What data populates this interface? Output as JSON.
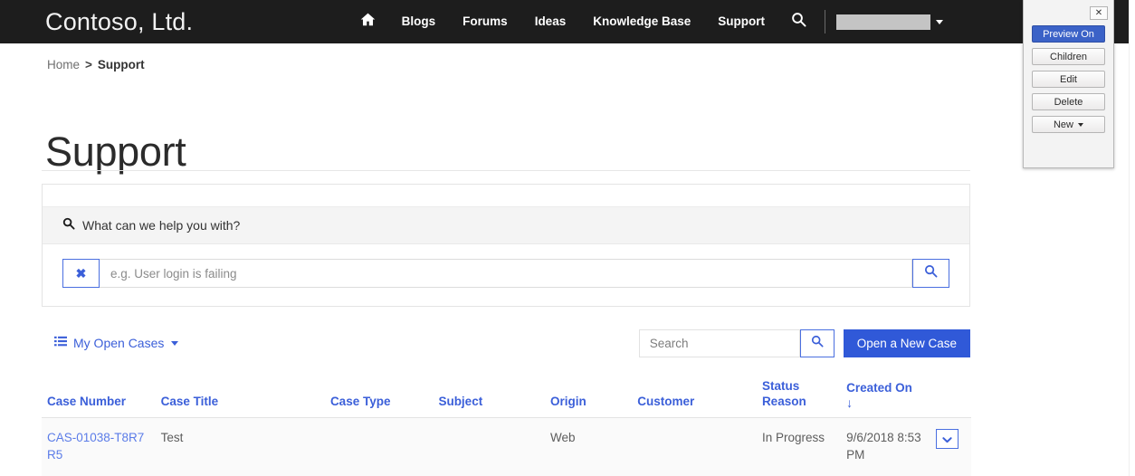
{
  "navbar": {
    "brand": "Contoso, Ltd.",
    "home_icon": "home-icon",
    "search_icon": "search-icon",
    "items": [
      {
        "label": "Blogs"
      },
      {
        "label": "Forums"
      },
      {
        "label": "Ideas"
      },
      {
        "label": "Knowledge Base"
      },
      {
        "label": "Support"
      }
    ],
    "user": {
      "name": "",
      "caret": "chevron-down-icon"
    },
    "background": "#1d1d1d"
  },
  "breadcrumb": {
    "home": "Home",
    "separator": ">",
    "current": "Support"
  },
  "page": {
    "title": "Support"
  },
  "help_search": {
    "heading": "What can we help you with?",
    "heading_icon": "search-icon",
    "clear_label": "✖",
    "input_value": "",
    "input_placeholder": "e.g. User login is failing",
    "submit_icon": "search-icon"
  },
  "toolbar": {
    "view_icon": "list-icon",
    "view_label": "My Open Cases",
    "view_caret": "caret-down-icon",
    "search_value": "",
    "search_placeholder": "Search",
    "search_icon": "search-icon",
    "new_case_label": "Open a New Case",
    "accent_color": "#3059d8"
  },
  "grid": {
    "columns": [
      {
        "label": "Case Number",
        "sorted": false
      },
      {
        "label": "Case Title",
        "sorted": false
      },
      {
        "label": "Case Type",
        "sorted": false
      },
      {
        "label": "Subject",
        "sorted": false
      },
      {
        "label": "Origin",
        "sorted": false
      },
      {
        "label": "Customer",
        "sorted": false
      },
      {
        "label": "Status Reason",
        "sorted": false
      },
      {
        "label": "Created On",
        "sorted": true,
        "sort_arrow": "↓"
      }
    ],
    "rows": [
      {
        "case_number": "CAS-01038-T8R7R5",
        "case_title": "Test",
        "case_type": "",
        "subject": "",
        "origin": "Web",
        "customer": "",
        "status_reason": "In Progress",
        "created_on": "9/6/2018 8:53 PM",
        "menu_icon": "chevron-down-icon"
      }
    ]
  },
  "edit_panel": {
    "close_label": "✕",
    "buttons": [
      {
        "label": "Preview On",
        "state": "active"
      },
      {
        "label": "Children",
        "state": "default"
      },
      {
        "label": "Edit",
        "state": "default"
      },
      {
        "label": "Delete",
        "state": "default"
      },
      {
        "label": "New",
        "state": "default",
        "caret": "caret-down-icon"
      }
    ]
  }
}
